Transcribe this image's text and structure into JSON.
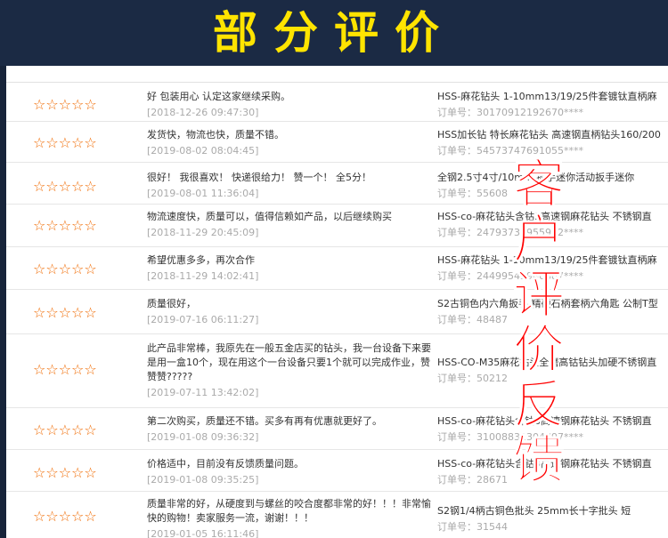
{
  "banner": {
    "title": "部分评价"
  },
  "overlay": {
    "vertical_text": [
      "客",
      "户",
      "评",
      "价",
      "反",
      "馈"
    ]
  },
  "reviews": [
    {
      "stars": "☆☆☆☆☆",
      "comment": "好 包装用心 认定这家继续采购。",
      "date": "[2018-12-26 09:47:30]",
      "product": "HSS-麻花钻头 1-10mm13/19/25件套镀钛直柄麻",
      "order": "订单号：30170912192670****"
    },
    {
      "stars": "☆☆☆☆☆",
      "comment": "发货快，物流也快，质量不错。",
      "date": "[2019-08-02 08:04:45]",
      "product": "HSS加长钻 特长麻花钻头 高速钢直柄钻头160/200",
      "order": "订单号：54573747691055****"
    },
    {
      "stars": "☆☆☆☆☆",
      "comment": "很好！ 我很喜欢！ 快递很给力！ 赞一个！ 全5分！",
      "date": "[2019-08-01 11:36:04]",
      "product": "全钢2.5寸4寸/10mm 扳手迷你活动扳手迷你",
      "order": "订单号：55608"
    },
    {
      "stars": "☆☆☆☆☆",
      "comment": "物流速度快，质量可以，值得信赖如产品，以后继续购买",
      "date": "[2018-11-29 20:45:09]",
      "product": "HSS-co-麻花钻头含钴3高速钢麻花钻头 不锈钢直",
      "order": "订单号：24793734955902****"
    },
    {
      "stars": "☆☆☆☆☆",
      "comment": "希望优惠多多，再次合作",
      "date": "[2018-11-29 14:02:41]",
      "product": "HSS-麻花钻头 1-10mm13/19/25件套镀钛直柄麻",
      "order": "订单号：24499543946887****"
    },
    {
      "stars": "☆☆☆☆☆",
      "comment": "质量很好，",
      "date": "[2019-07-16 06:11:27]",
      "product": "S2古铜色内六角扳手 精硬石柄套柄六角匙 公制T型",
      "order": "订单号：48487"
    },
    {
      "stars": "☆☆☆☆☆",
      "comment": "此产品非常棒，我原先在一般五金店买的钻头，我一台设备下来要是用一盒10个，现在用这个一台设备只要1个就可以完成作业，赞赞赞?????",
      "date": "[2019-07-11 13:42:02]",
      "product": "HSS-CO-M35麻花钻头全磨高钴钻头加硬不锈钢直",
      "order": "订单号：50212"
    },
    {
      "stars": "☆☆☆☆☆",
      "comment": "第二次购买，质量还不错。买多有再有优惠就更好了。",
      "date": "[2019-01-08 09:36:32]",
      "product": "HSS-co-麻花钻头含钴3高速钢麻花钻头 不锈钢直",
      "order": "订单号：31008832304797****"
    },
    {
      "stars": "☆☆☆☆☆",
      "comment": "价格适中，目前没有反馈质量问题。",
      "date": "[2019-01-08 09:35:25]",
      "product": "HSS-co-麻花钻头含钴3高速钢麻花钻头 不锈钢直",
      "order": "订单号：28671"
    },
    {
      "stars": "☆☆☆☆☆",
      "comment": "质量非常的好，从硬度到与螺丝的咬合度都非常的好！！！非常愉快的购物！卖家服务一流，谢谢！！！",
      "date": "[2019-01-05 16:11:46]",
      "product": "S2钢1/4柄古铜色批头 25mm长十字批头 短",
      "order": "订单号：31544"
    }
  ]
}
